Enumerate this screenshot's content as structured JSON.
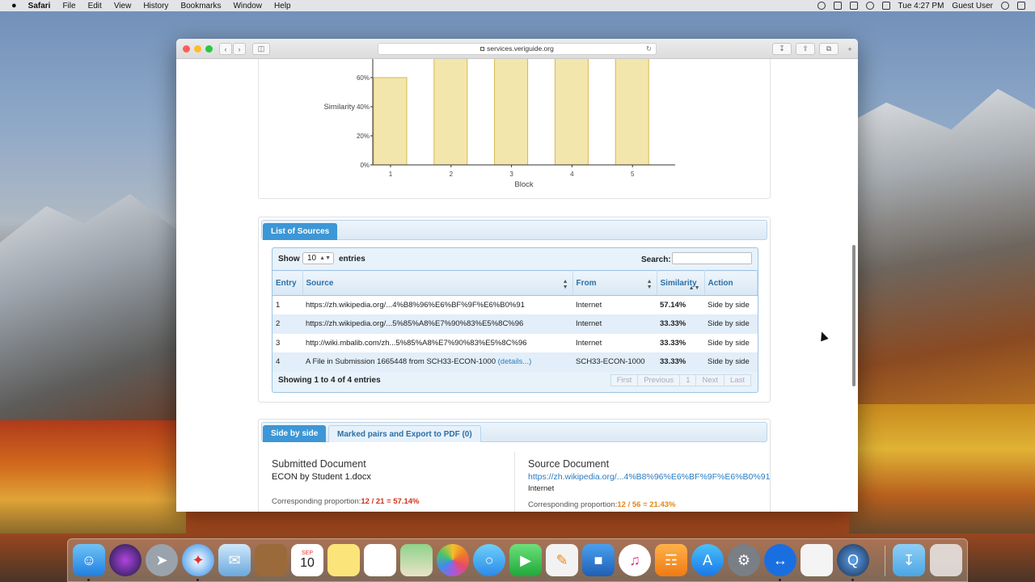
{
  "menubar": {
    "apple": "",
    "items": [
      "Safari",
      "File",
      "Edit",
      "View",
      "History",
      "Bookmarks",
      "Window",
      "Help"
    ],
    "clock": "Tue 4:27 PM",
    "user": "Guest User"
  },
  "browser": {
    "url": "services.veriguide.org"
  },
  "chart_data": {
    "type": "bar",
    "categories": [
      "1",
      "2",
      "3",
      "4",
      "5"
    ],
    "values": [
      60,
      100,
      100,
      100,
      100
    ],
    "xlabel": "Block",
    "ylabel": "Similarity",
    "y_ticks": [
      "0%",
      "20%",
      "40%",
      "60%"
    ],
    "ylim": [
      0,
      100
    ],
    "bar_color": "#f3e6ac",
    "bar_border": "#d8b84a"
  },
  "sources_panel": {
    "tab_label": "List of Sources",
    "show_label": "Show",
    "show_value": "10",
    "entries_label": "entries",
    "search_label": "Search:",
    "columns": [
      "Entry",
      "Source",
      "From",
      "Similarity",
      "Action"
    ],
    "rows": [
      {
        "entry": "1",
        "source": "https://zh.wikipedia.org/...4%B8%96%E6%BF%9F%E6%B0%91",
        "details": "",
        "from": "Internet",
        "similarity": "57.14%",
        "action": "Side by side"
      },
      {
        "entry": "2",
        "source": "https://zh.wikipedia.org/...5%85%A8%E7%90%83%E5%8C%96",
        "details": "",
        "from": "Internet",
        "similarity": "33.33%",
        "action": "Side by side"
      },
      {
        "entry": "3",
        "source": "http://wiki.mbalib.com/zh...5%85%A8%E7%90%83%E5%8C%96",
        "details": "",
        "from": "Internet",
        "similarity": "33.33%",
        "action": "Side by side"
      },
      {
        "entry": "4",
        "source": "A File in Submission 1665448 from SCH33-ECON-1000",
        "details": "(details...)",
        "from": "SCH33-ECON-1000",
        "similarity": "33.33%",
        "action": "Side by side"
      }
    ],
    "info": "Showing 1 to 4 of 4 entries",
    "pager": [
      "First",
      "Previous",
      "1",
      "Next",
      "Last"
    ]
  },
  "compare_panel": {
    "tabs": [
      "Side by side",
      "Marked pairs and Export to PDF (0)"
    ],
    "submitted": {
      "heading": "Submitted Document",
      "name": "ECON by Student 1.docx",
      "prop_label": "Corresponding proportion:",
      "prop_value": "12 / 21 = 57.14%"
    },
    "source": {
      "heading": "Source Document",
      "url": "https://zh.wikipedia.org/...4%B8%96%E6%BF%9F%E6%B0%91",
      "from": "Internet",
      "prop_label": "Corresponding proportion:",
      "prop_value": "12 / 56 = 21.43%"
    }
  },
  "dock": {
    "calendar_month": "SEP",
    "calendar_day": "10",
    "icons": [
      "finder-icon",
      "siri-icon",
      "launchpad-icon",
      "safari-icon",
      "mail-icon",
      "notes-app-icon",
      "calendar-icon",
      "stickies-icon",
      "reminders-icon",
      "maps-icon",
      "photos-icon",
      "messages-icon",
      "facetime-icon",
      "pages-icon",
      "keynote-icon",
      "music-icon",
      "books-icon",
      "app-store-icon",
      "system-preferences-icon",
      "teamviewer-icon",
      "textedit-icon",
      "quicktime-icon",
      "downloads-icon",
      "trash-icon"
    ]
  }
}
